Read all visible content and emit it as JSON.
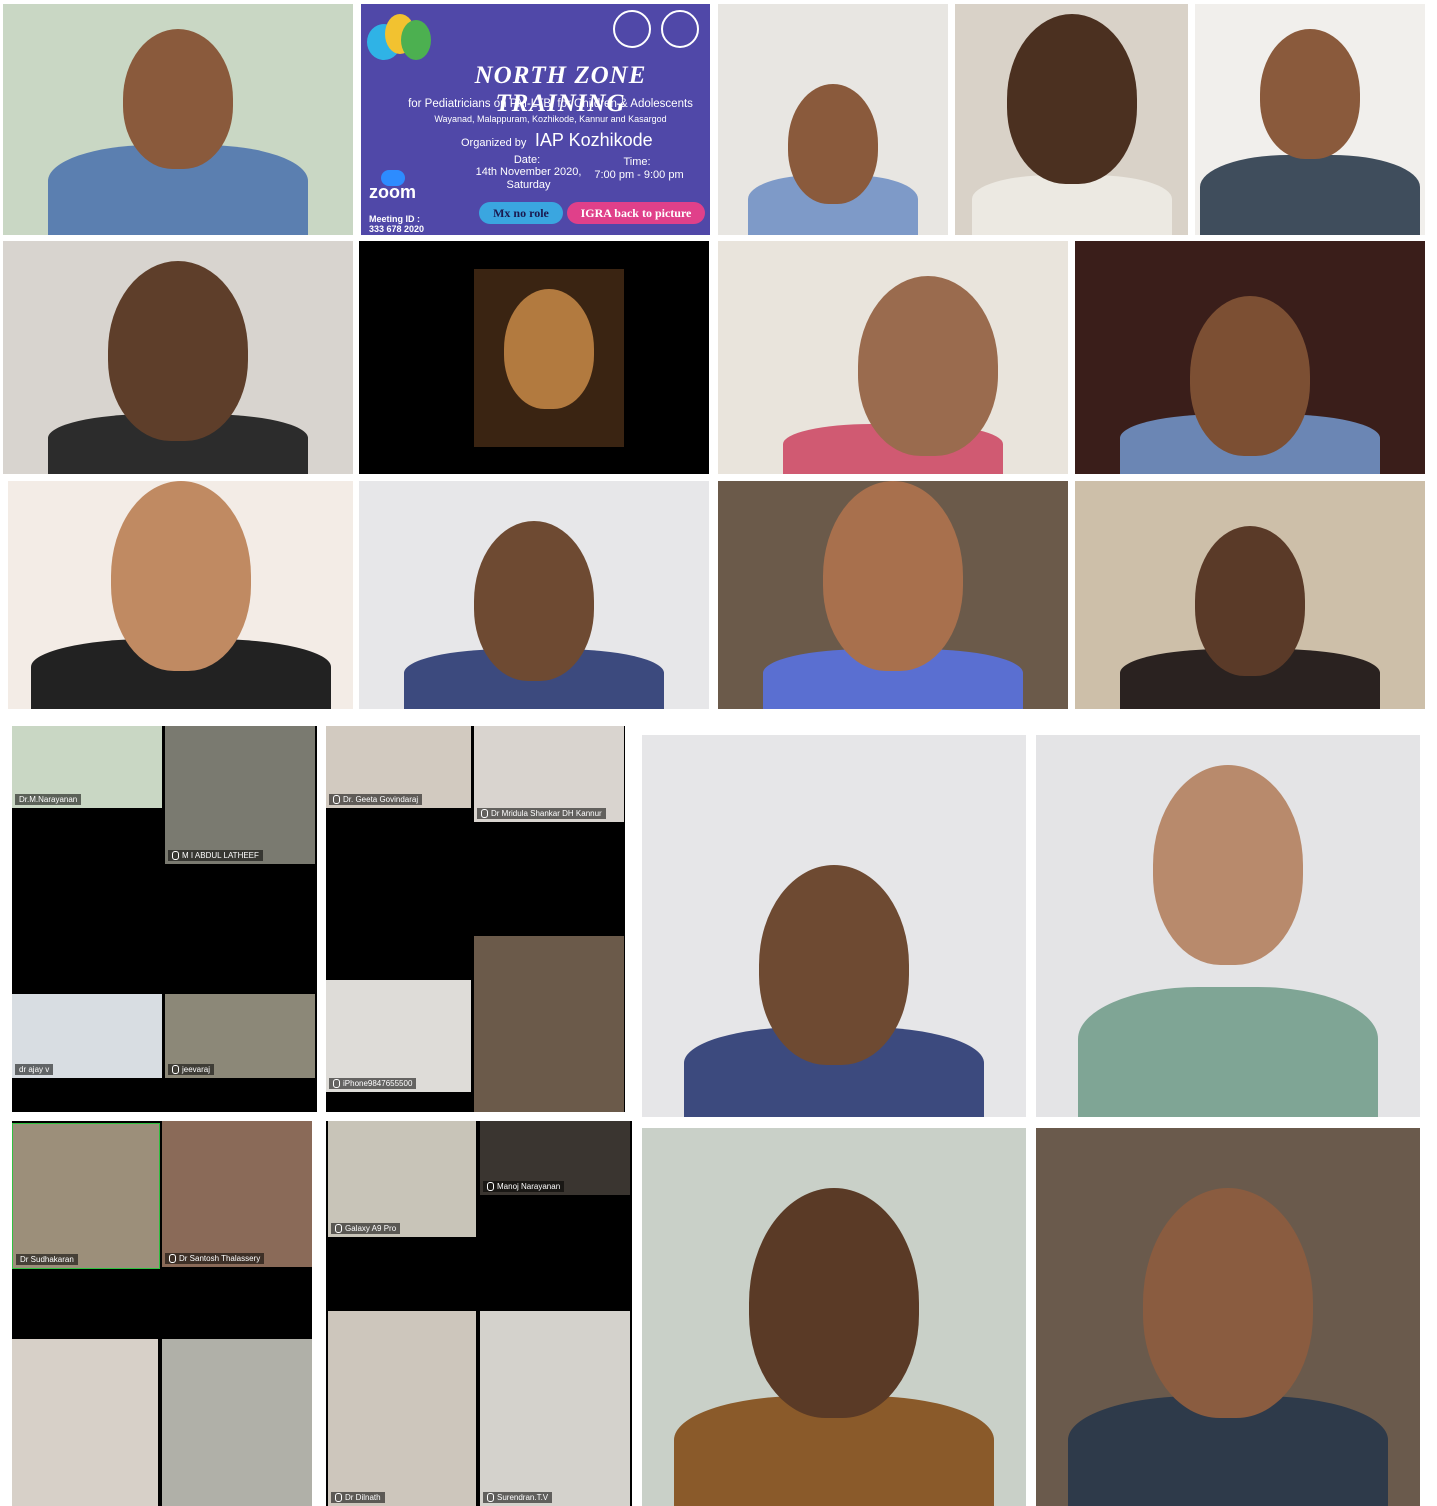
{
  "banner": {
    "title": "NORTH ZONE TRAINING",
    "subtitle": "for Pediatricians on PM-LTBI for Children & Adolescents",
    "districts": "Wayanad, Malappuram, Kozhikode, Kannur and Kasargod",
    "organized_prefix": "Organized by",
    "organizer": "IAP Kozhikode",
    "date_label": "Date:",
    "date_value": "14th November 2020,",
    "day_value": "Saturday",
    "time_label": "Time:",
    "time_value": "7:00 pm - 9:00 pm",
    "zoom_label": "zoom",
    "meeting_id_label": "Meeting ID :",
    "meeting_id_value": "333 678 2020",
    "pill_1": "Mx no role",
    "pill_2": "IGRA back to picture",
    "colors": {
      "background": "#5048a8",
      "pill_1": "#3aa6e0",
      "pill_2": "#e0408a"
    }
  },
  "names": {
    "g1": [
      "Dr.M.Narayanan",
      "M I ABDUL LATHEEF",
      "dr ajay v",
      "jeevaraj"
    ],
    "g2": [
      "Dr. Geeta Govindaraj",
      "Dr Mridula Shankar DH Kannur",
      "iPhone9847655500"
    ],
    "g3": [
      "Dr Sudhakaran",
      "Dr Santosh Thalassery"
    ],
    "g4": [
      "Galaxy A9 Pro",
      "Manoj Narayanan",
      "Dr Dilnath",
      "Surendran.T.V"
    ]
  }
}
